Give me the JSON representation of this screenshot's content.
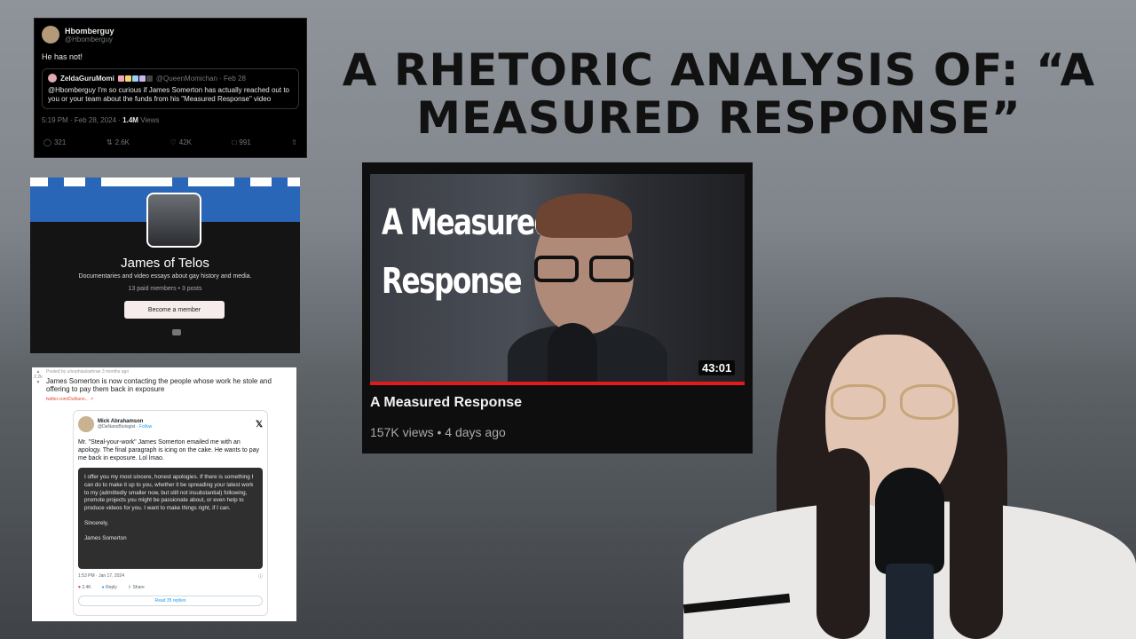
{
  "headline": {
    "line1": "A RHETORIC ANALYSIS OF: “A",
    "line2": "MEASURED RESPONSE”"
  },
  "tweet": {
    "name": "Hbomberguy",
    "handle": "@Hbomberguy",
    "text": "He has not!",
    "quote": {
      "name": "ZeldaGuruMomi",
      "handle": "@QueenMomichan · Feb 28",
      "text": "@Hbomberguy I'm so curious if James Somerton has actually reached out to you or your team about the funds from his \"Measured Response\" video"
    },
    "timestamp": "5:19 PM · Feb 28, 2024 · ",
    "views_count": "1.4M",
    "views_label": " Views",
    "actions": {
      "replies": "321",
      "retweets": "2.6K",
      "likes": "42K",
      "bookmarks": "991"
    }
  },
  "creator": {
    "name": "James of Telos",
    "description": "Documentaries and video essays about gay history and media.",
    "stats": "13 paid members  •  3 posts",
    "button": "Become a member"
  },
  "reddit": {
    "votes": "2.2k",
    "posted": "Posted by u/sophiaslashrae 3 months ago",
    "title": "James Somerton is now contacting the people whose work he stole and offering to pay them back in exposure",
    "link": "twitter.com/DaNano... ↗",
    "embed": {
      "name": "Mick Abrahamson",
      "handle": "@DaNanoBiologist · ",
      "follow": "Follow",
      "text": "Mr. \"Steal-your-work\" James Somerton emailed me with an apology. The final paragraph is icing on the cake. He wants to pay me back in exposure. Lol lmao.",
      "letter_p1": "I offer you my most sincere, honest apologies. If there is something I can do to make it up to you, whether it be spreading your latest work to my (admittedly smaller now, but still not insubstantial) following, promote projects you might be passionate about, or even help to produce videos for you. I want to make things right, if I can.",
      "letter_p2": "Sincerely,",
      "letter_p3": "James Somerton",
      "time": "1:53 PM · Jan 17, 2024",
      "likes": "2.4K",
      "reply": "Reply",
      "share": "Share",
      "read_replies": "Read 35 replies"
    }
  },
  "video": {
    "thumb_line1": "A Measured",
    "thumb_line2": "Response",
    "duration": "43:01",
    "title": "A Measured Response",
    "meta": "157K views • 4 days ago",
    "progress": 1.0
  }
}
